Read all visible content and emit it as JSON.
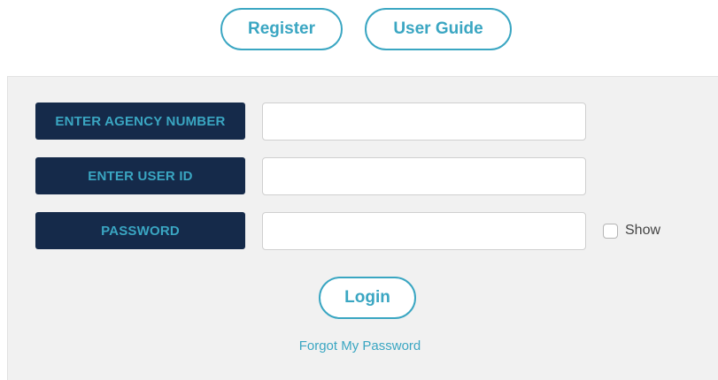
{
  "header": {
    "register_label": "Register",
    "user_guide_label": "User Guide"
  },
  "form": {
    "agency_label": "ENTER AGENCY NUMBER",
    "agency_value": "",
    "user_id_label": "ENTER USER ID",
    "user_id_value": "",
    "password_label": "PASSWORD",
    "password_value": "",
    "show_label": "Show",
    "show_checked": false,
    "login_label": "Login",
    "forgot_label": "Forgot My Password"
  },
  "colors": {
    "accent": "#3aa6c2",
    "label_bg": "#152a4a",
    "panel_bg": "#f1f1f1"
  }
}
